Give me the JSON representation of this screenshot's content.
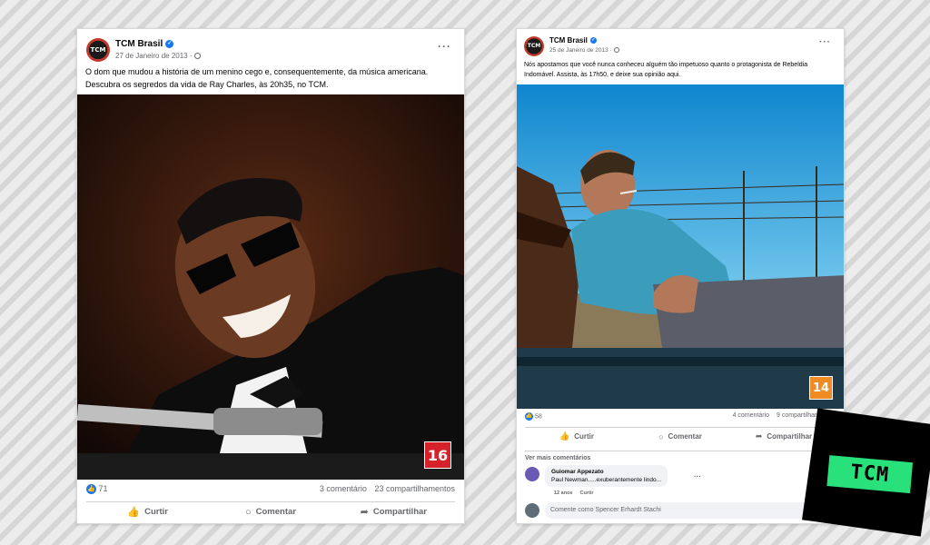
{
  "posts": [
    {
      "page_name": "TCM Brasil",
      "avatar_text": "TCM",
      "date": "27 de Janeiro de 2013 ·",
      "text": "O dom que mudou a história de um menino cego e, consequentemente, da música americana. Descubra os segredos da vida de Ray Charles, às 20h35, no TCM.",
      "rating": "16",
      "rating_color": "#d5222a",
      "likes": "71",
      "comments": "3 comentário",
      "shares": "23 compartilhamentos",
      "actions": {
        "like": "Curtir",
        "comment": "Comentar",
        "share": "Compartilhar"
      }
    },
    {
      "page_name": "TCM Brasil",
      "avatar_text": "TCM",
      "date": "25 de Janeiro de 2013 ·",
      "text": "Nós apostamos que você nunca conheceu alguém tão impetuoso quanto o protagonista de Rebeldia Indomável. Assista, às 17h50, e deixe sua opinião aqui.",
      "rating": "14",
      "rating_color": "#f08a23",
      "likes": "58",
      "comments": "4 comentário",
      "shares": "9 compartilhamentos",
      "actions": {
        "like": "Curtir",
        "comment": "Comentar",
        "share": "Compartilhar"
      },
      "more_comments": "Ver mais comentários",
      "comment": {
        "author": "Guiomar Appezato",
        "text": "Paul Newman.....exuberantemente lindo...",
        "age": "12 anos",
        "like_label": "Curtir"
      },
      "composer_placeholder": "Comente como Spencer Erhardt Stachi"
    }
  ],
  "logo": {
    "text": "TCM"
  }
}
